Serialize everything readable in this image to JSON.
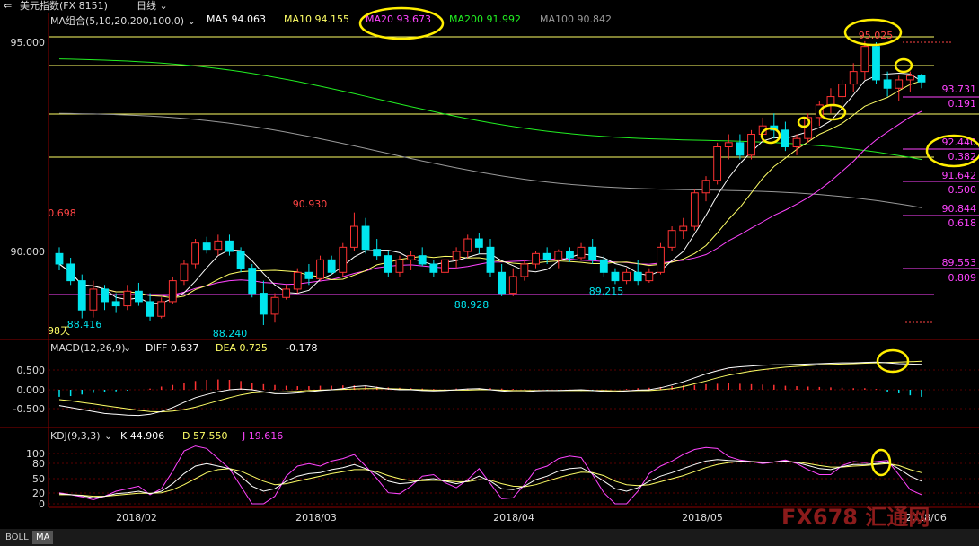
{
  "header": {
    "icon": "back-arrow-icon",
    "title": "美元指数(FX 8151)",
    "period": "日线",
    "period_caret": "chevron-down-icon"
  },
  "main_legend": {
    "label": "MA组合(5,10,20,200,100,0)",
    "items": [
      {
        "name": "MA5",
        "text": "MA5 94.063",
        "color": "#ffffff"
      },
      {
        "name": "MA10",
        "text": "MA10 94.155",
        "color": "#ffff66"
      },
      {
        "name": "MA20",
        "text": "MA20 93.673",
        "color": "#ff44ff"
      },
      {
        "name": "MA200",
        "text": "MA200 91.992",
        "color": "#22ee22"
      },
      {
        "name": "MA100",
        "text": "MA100 90.842",
        "color": "#999999"
      }
    ]
  },
  "macd_legend": {
    "label": "MACD(12,26,9)",
    "diff": "DIFF 0.637",
    "dea": "DEA 0.725",
    "macd": "-0.178"
  },
  "kdj_legend": {
    "label": "KDJ(9,3,3)",
    "k": "K 44.906",
    "d": "D 57.550",
    "j": "J 19.616"
  },
  "price_axis": [
    "95.000",
    "90.000"
  ],
  "macd_axis": [
    "0.500",
    "0.000",
    "-0.500"
  ],
  "kdj_axis": [
    "100",
    "80",
    "50",
    "20",
    "0"
  ],
  "x_labels": [
    "2018/02",
    "2018/03",
    "2018/04",
    "2018/05",
    "2018/06"
  ],
  "annotations": {
    "high_label": "95.025",
    "price_labels": [
      "90.930",
      "0.698",
      "88.416",
      "88.240",
      "88.928",
      "89.215"
    ],
    "days_label": "98天"
  },
  "fib_levels": [
    {
      "price": "93.731",
      "ratio": "0.191"
    },
    {
      "price": "92.440",
      "ratio": "0.382"
    },
    {
      "price": "91.642",
      "ratio": "0.500"
    },
    {
      "price": "90.844",
      "ratio": "0.618"
    },
    {
      "price": "89.553",
      "ratio": "0.809"
    }
  ],
  "bottom_tabs": [
    "BOLL",
    "MA"
  ],
  "watermark": "FX678 汇通网",
  "colors": {
    "up": "#ff3333",
    "down": "#00e5ee",
    "fib": "#ff44ff",
    "hline": "#ffff66",
    "circle": "#ffee00"
  },
  "chart_data": {
    "type": "candlestick",
    "title": "美元指数(FX 8151) 日线",
    "x_range": [
      "2018-01-22",
      "2018-06-05"
    ],
    "ylim": [
      87.6,
      95.4
    ],
    "candles": [
      [
        89.95,
        90.1,
        89.55,
        89.7
      ],
      [
        89.7,
        89.85,
        89.2,
        89.3
      ],
      [
        89.3,
        89.45,
        88.4,
        88.6
      ],
      [
        88.6,
        89.3,
        88.42,
        89.1
      ],
      [
        89.1,
        89.2,
        88.6,
        88.8
      ],
      [
        88.8,
        89.0,
        88.55,
        88.7
      ],
      [
        88.7,
        89.2,
        88.6,
        89.05
      ],
      [
        89.05,
        89.25,
        88.7,
        88.8
      ],
      [
        88.8,
        89.0,
        88.35,
        88.45
      ],
      [
        88.45,
        88.9,
        88.4,
        88.8
      ],
      [
        88.8,
        89.4,
        88.75,
        89.3
      ],
      [
        89.3,
        89.8,
        89.2,
        89.7
      ],
      [
        89.7,
        90.3,
        89.6,
        90.2
      ],
      [
        90.2,
        90.35,
        89.95,
        90.05
      ],
      [
        90.05,
        90.4,
        89.9,
        90.25
      ],
      [
        90.25,
        90.4,
        89.9,
        90.0
      ],
      [
        90.0,
        90.1,
        89.5,
        89.6
      ],
      [
        89.6,
        89.7,
        88.9,
        89.0
      ],
      [
        89.0,
        89.3,
        88.24,
        88.5
      ],
      [
        88.5,
        89.0,
        88.3,
        88.9
      ],
      [
        88.9,
        89.2,
        88.85,
        89.1
      ],
      [
        89.1,
        89.6,
        89.0,
        89.5
      ],
      [
        89.5,
        89.7,
        89.2,
        89.35
      ],
      [
        89.35,
        89.9,
        89.3,
        89.8
      ],
      [
        89.8,
        89.9,
        89.45,
        89.5
      ],
      [
        89.5,
        90.2,
        89.4,
        90.1
      ],
      [
        90.1,
        90.93,
        90.0,
        90.6
      ],
      [
        90.6,
        90.8,
        89.95,
        90.05
      ],
      [
        90.05,
        90.3,
        89.8,
        89.9
      ],
      [
        89.9,
        90.0,
        89.4,
        89.5
      ],
      [
        89.5,
        89.9,
        89.4,
        89.8
      ],
      [
        89.8,
        90.0,
        89.55,
        89.9
      ],
      [
        89.9,
        90.1,
        89.65,
        89.7
      ],
      [
        89.7,
        89.8,
        89.4,
        89.5
      ],
      [
        89.5,
        89.9,
        89.45,
        89.8
      ],
      [
        89.8,
        90.1,
        89.6,
        90.0
      ],
      [
        90.0,
        90.4,
        89.85,
        90.3
      ],
      [
        90.3,
        90.45,
        89.95,
        90.1
      ],
      [
        90.1,
        90.3,
        89.4,
        89.5
      ],
      [
        89.5,
        89.7,
        88.93,
        89.0
      ],
      [
        89.0,
        89.6,
        88.93,
        89.4
      ],
      [
        89.4,
        89.8,
        89.3,
        89.7
      ],
      [
        89.7,
        90.0,
        89.6,
        89.95
      ],
      [
        89.95,
        90.1,
        89.7,
        89.8
      ],
      [
        89.8,
        90.05,
        89.6,
        90.0
      ],
      [
        90.0,
        90.1,
        89.75,
        89.85
      ],
      [
        89.85,
        90.2,
        89.8,
        90.1
      ],
      [
        90.1,
        90.3,
        89.7,
        89.8
      ],
      [
        89.8,
        89.9,
        89.4,
        89.5
      ],
      [
        89.5,
        89.6,
        89.22,
        89.3
      ],
      [
        89.3,
        89.6,
        89.22,
        89.5
      ],
      [
        89.5,
        89.8,
        89.2,
        89.3
      ],
      [
        89.3,
        89.6,
        89.25,
        89.5
      ],
      [
        89.5,
        90.2,
        89.45,
        90.1
      ],
      [
        90.1,
        90.6,
        90.0,
        90.5
      ],
      [
        90.5,
        90.8,
        90.3,
        90.6
      ],
      [
        90.6,
        91.5,
        90.5,
        91.4
      ],
      [
        91.4,
        91.8,
        91.2,
        91.7
      ],
      [
        91.7,
        92.6,
        91.6,
        92.5
      ],
      [
        92.5,
        92.8,
        92.2,
        92.6
      ],
      [
        92.6,
        92.8,
        92.2,
        92.3
      ],
      [
        92.3,
        92.9,
        92.2,
        92.8
      ],
      [
        92.8,
        93.2,
        92.6,
        93.0
      ],
      [
        93.0,
        93.3,
        92.7,
        92.9
      ],
      [
        92.9,
        93.1,
        92.4,
        92.5
      ],
      [
        92.5,
        92.8,
        92.3,
        92.7
      ],
      [
        92.7,
        93.3,
        92.6,
        93.2
      ],
      [
        93.2,
        93.6,
        93.0,
        93.5
      ],
      [
        93.5,
        93.9,
        93.3,
        93.7
      ],
      [
        93.7,
        94.1,
        93.5,
        94.0
      ],
      [
        94.0,
        94.5,
        93.8,
        94.3
      ],
      [
        94.3,
        95.025,
        94.1,
        94.9
      ],
      [
        94.9,
        95.0,
        94.0,
        94.1
      ],
      [
        94.1,
        94.3,
        93.7,
        93.9
      ],
      [
        93.9,
        94.2,
        93.6,
        94.1
      ],
      [
        94.1,
        94.3,
        93.8,
        94.2
      ],
      [
        94.2,
        94.25,
        93.9,
        94.05
      ]
    ],
    "moving_averages": [
      {
        "name": "MA200",
        "color": "#22ee22",
        "start": 94.6,
        "end": 91.99
      },
      {
        "name": "MA100",
        "color": "#999999",
        "start": 93.3,
        "end": 90.84
      }
    ],
    "macd": {
      "ylim": [
        -0.9,
        0.75
      ],
      "hist": [
        -0.18,
        -0.16,
        -0.12,
        -0.08,
        -0.06,
        -0.04,
        -0.02,
        0.0,
        0.03,
        0.08,
        0.12,
        0.16,
        0.22,
        0.25,
        0.26,
        0.25,
        0.22,
        0.18,
        0.14,
        0.12,
        0.1,
        0.09,
        0.09,
        0.1,
        0.1,
        0.11,
        0.11,
        0.1,
        0.08,
        0.06,
        0.05,
        0.04,
        0.03,
        0.02,
        0.02,
        0.03,
        0.03,
        0.04,
        0.04,
        0.03,
        0.02,
        0.01,
        0.0,
        -0.01,
        -0.02,
        -0.02,
        -0.03,
        -0.02,
        -0.01,
        0.0,
        0.02,
        0.04,
        0.05,
        0.07,
        0.09,
        0.11,
        0.12,
        0.14,
        0.15,
        0.16,
        0.15,
        0.14,
        0.13,
        0.12,
        0.1,
        0.09,
        0.08,
        0.07,
        0.06,
        0.05,
        0.04,
        0.04,
        0.02,
        -0.05,
        -0.09,
        -0.14,
        -0.18
      ],
      "diff": [
        -0.4,
        -0.45,
        -0.5,
        -0.55,
        -0.6,
        -0.62,
        -0.64,
        -0.65,
        -0.62,
        -0.55,
        -0.45,
        -0.32,
        -0.2,
        -0.12,
        -0.05,
        0.0,
        0.02,
        0.0,
        -0.05,
        -0.1,
        -0.1,
        -0.08,
        -0.05,
        -0.02,
        0.0,
        0.03,
        0.08,
        0.1,
        0.06,
        0.02,
        0.0,
        0.0,
        -0.02,
        -0.03,
        -0.02,
        0.0,
        0.02,
        0.03,
        0.0,
        -0.03,
        -0.05,
        -0.05,
        -0.03,
        -0.02,
        -0.02,
        -0.01,
        0.0,
        -0.02,
        -0.04,
        -0.05,
        -0.03,
        -0.01,
        0.0,
        0.05,
        0.12,
        0.2,
        0.3,
        0.4,
        0.48,
        0.55,
        0.58,
        0.6,
        0.62,
        0.63,
        0.63,
        0.64,
        0.65,
        0.66,
        0.67,
        0.68,
        0.68,
        0.69,
        0.7,
        0.68,
        0.66,
        0.65,
        0.64
      ],
      "dea": [
        -0.25,
        -0.28,
        -0.32,
        -0.36,
        -0.4,
        -0.44,
        -0.48,
        -0.52,
        -0.55,
        -0.56,
        -0.54,
        -0.5,
        -0.44,
        -0.36,
        -0.28,
        -0.2,
        -0.13,
        -0.08,
        -0.06,
        -0.06,
        -0.05,
        -0.04,
        -0.02,
        -0.01,
        0.0,
        0.01,
        0.02,
        0.03,
        0.03,
        0.03,
        0.02,
        0.01,
        0.0,
        -0.01,
        -0.01,
        -0.01,
        -0.01,
        0.0,
        0.0,
        -0.01,
        -0.02,
        -0.02,
        -0.02,
        -0.02,
        -0.02,
        -0.02,
        -0.02,
        -0.02,
        -0.02,
        -0.03,
        -0.03,
        -0.02,
        -0.02,
        0.0,
        0.03,
        0.08,
        0.15,
        0.22,
        0.3,
        0.37,
        0.42,
        0.47,
        0.51,
        0.54,
        0.57,
        0.59,
        0.61,
        0.63,
        0.64,
        0.65,
        0.66,
        0.67,
        0.68,
        0.69,
        0.7,
        0.71,
        0.72
      ]
    },
    "kdj": {
      "ylim": [
        0,
        110
      ],
      "k": [
        20,
        18,
        16,
        12,
        15,
        20,
        22,
        25,
        20,
        25,
        40,
        60,
        75,
        80,
        75,
        70,
        55,
        35,
        25,
        30,
        45,
        55,
        60,
        62,
        68,
        72,
        78,
        70,
        60,
        45,
        40,
        42,
        48,
        50,
        45,
        40,
        45,
        55,
        45,
        30,
        28,
        35,
        48,
        55,
        65,
        70,
        72,
        60,
        45,
        30,
        25,
        32,
        45,
        55,
        62,
        70,
        78,
        85,
        88,
        86,
        85,
        84,
        82,
        83,
        85,
        82,
        76,
        70,
        68,
        74,
        78,
        78,
        80,
        82,
        70,
        55,
        45
      ],
      "d": [
        18,
        18,
        17,
        15,
        15,
        17,
        19,
        21,
        21,
        22,
        28,
        38,
        50,
        62,
        68,
        70,
        65,
        55,
        45,
        38,
        40,
        45,
        50,
        55,
        60,
        64,
        68,
        68,
        64,
        56,
        50,
        46,
        46,
        47,
        46,
        44,
        44,
        48,
        47,
        40,
        35,
        34,
        38,
        45,
        52,
        58,
        63,
        62,
        56,
        45,
        38,
        36,
        38,
        44,
        50,
        56,
        64,
        72,
        78,
        82,
        84,
        84,
        83,
        83,
        84,
        83,
        80,
        76,
        73,
        73,
        75,
        76,
        78,
        80,
        76,
        68,
        62
      ],
      "j": [
        22,
        18,
        14,
        8,
        15,
        25,
        30,
        35,
        18,
        30,
        65,
        105,
        115,
        110,
        90,
        70,
        35,
        0,
        0,
        15,
        55,
        75,
        80,
        75,
        85,
        90,
        98,
        75,
        50,
        22,
        20,
        35,
        55,
        58,
        42,
        32,
        48,
        70,
        40,
        10,
        12,
        38,
        68,
        75,
        90,
        95,
        92,
        58,
        22,
        0,
        0,
        25,
        60,
        75,
        85,
        98,
        108,
        112,
        110,
        94,
        87,
        84,
        80,
        83,
        87,
        80,
        68,
        58,
        58,
        76,
        84,
        82,
        84,
        86,
        58,
        28,
        18
      ]
    }
  }
}
